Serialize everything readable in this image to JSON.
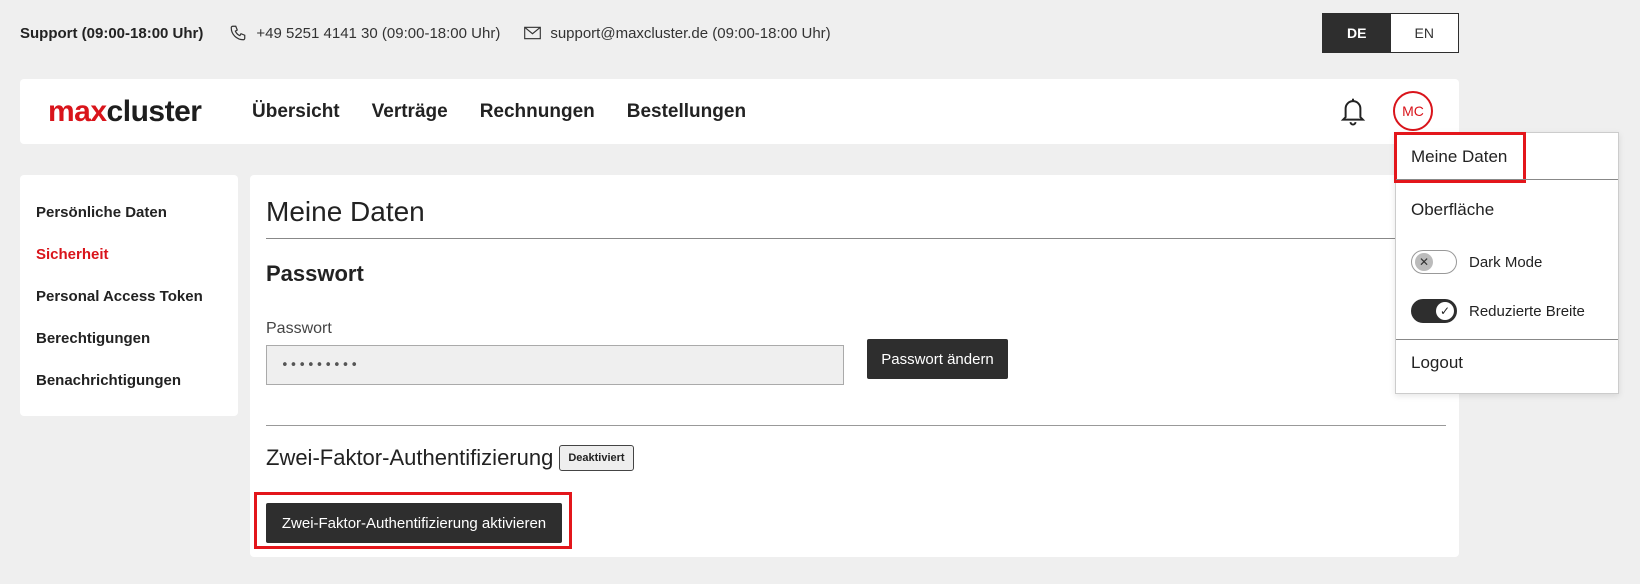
{
  "support": {
    "title": "Support (09:00-18:00 Uhr)",
    "phone": "+49 5251 4141 30 (09:00-18:00 Uhr)",
    "email": "support@maxcluster.de (09:00-18:00 Uhr)"
  },
  "language": {
    "active": "DE",
    "other": "EN"
  },
  "header": {
    "logo_left": "max",
    "logo_right": "cluster",
    "nav": [
      "Übersicht",
      "Verträge",
      "Rechnungen",
      "Bestellungen"
    ],
    "avatar_initials": "MC"
  },
  "sidebar": {
    "items": [
      {
        "label": "Persönliche Daten"
      },
      {
        "label": "Sicherheit"
      },
      {
        "label": "Personal Access Token"
      },
      {
        "label": "Berechtigungen"
      },
      {
        "label": "Benachrichtigungen"
      }
    ]
  },
  "main": {
    "title": "Meine Daten",
    "password_section": "Passwort",
    "password_label": "Passwort",
    "password_value": "•••••••••",
    "change_password_button": "Passwort ändern",
    "tfa_title": "Zwei-Faktor-Authentifizierung",
    "tfa_status": "Deaktiviert",
    "tfa_button": "Zwei-Faktor-Authentifizierung aktivieren"
  },
  "dropdown": {
    "my_data": "Meine Daten",
    "appearance": "Oberfläche",
    "dark_mode": "Dark Mode",
    "dark_mode_on": false,
    "reduced_width": "Reduzierte Breite",
    "reduced_width_on": true,
    "logout": "Logout"
  },
  "colors": {
    "brand": "#d9141b",
    "dark": "#2e2e2e",
    "highlight": "#e3161b"
  }
}
